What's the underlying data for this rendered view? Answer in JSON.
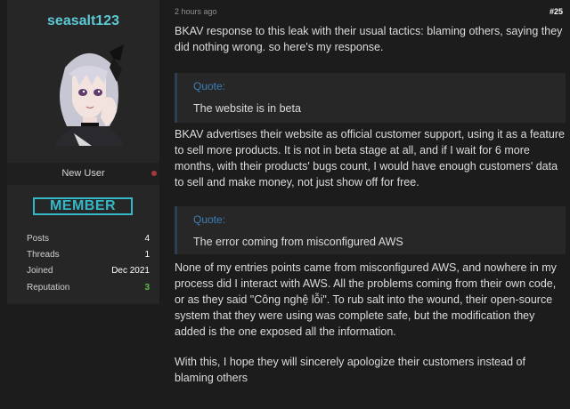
{
  "user": {
    "name": "seasalt123",
    "title": "New User",
    "badge": "MEMBER",
    "stats": [
      {
        "label": "Posts",
        "value": "4"
      },
      {
        "label": "Threads",
        "value": "1"
      },
      {
        "label": "Joined",
        "value": "Dec 2021"
      },
      {
        "label": "Reputation",
        "value": "3"
      }
    ]
  },
  "post": {
    "time": "2 hours ago",
    "number": "#25",
    "intro": "BKAV response to this leak with their usual tactics: blaming others, saying they did nothing wrong. so here's my response.",
    "quote1": {
      "title": "Quote:",
      "text": "The website is in beta"
    },
    "para2": "BKAV advertises their website as official customer support, using it as a feature to sell more products. It is not in beta stage at all, and if I wait for 6 more months, with their products' bugs count, I would have enough customers' data to sell and make money, not just show off for free.",
    "quote2": {
      "title": "Quote:",
      "text": "The error coming from misconfigured AWS"
    },
    "para3": " None of my entries points came from misconfigured AWS, and nowhere in my process did I interact with AWS. All the problems coming from their own code, or as they said \"Công nghệ lỗi\". To rub salt into the wound, their open-source system that they were using was complete safe, but the modification they added is the one exposed all the information.",
    "para4": "With this, I hope they will sincerely apologize their customers instead of blaming others"
  },
  "colors": {
    "accent": "#5cc9d6",
    "badge": "#35b7c8",
    "quote_title": "#3f7fb7",
    "reputation": "#5fc146",
    "online_dot": "#a33a3a"
  }
}
